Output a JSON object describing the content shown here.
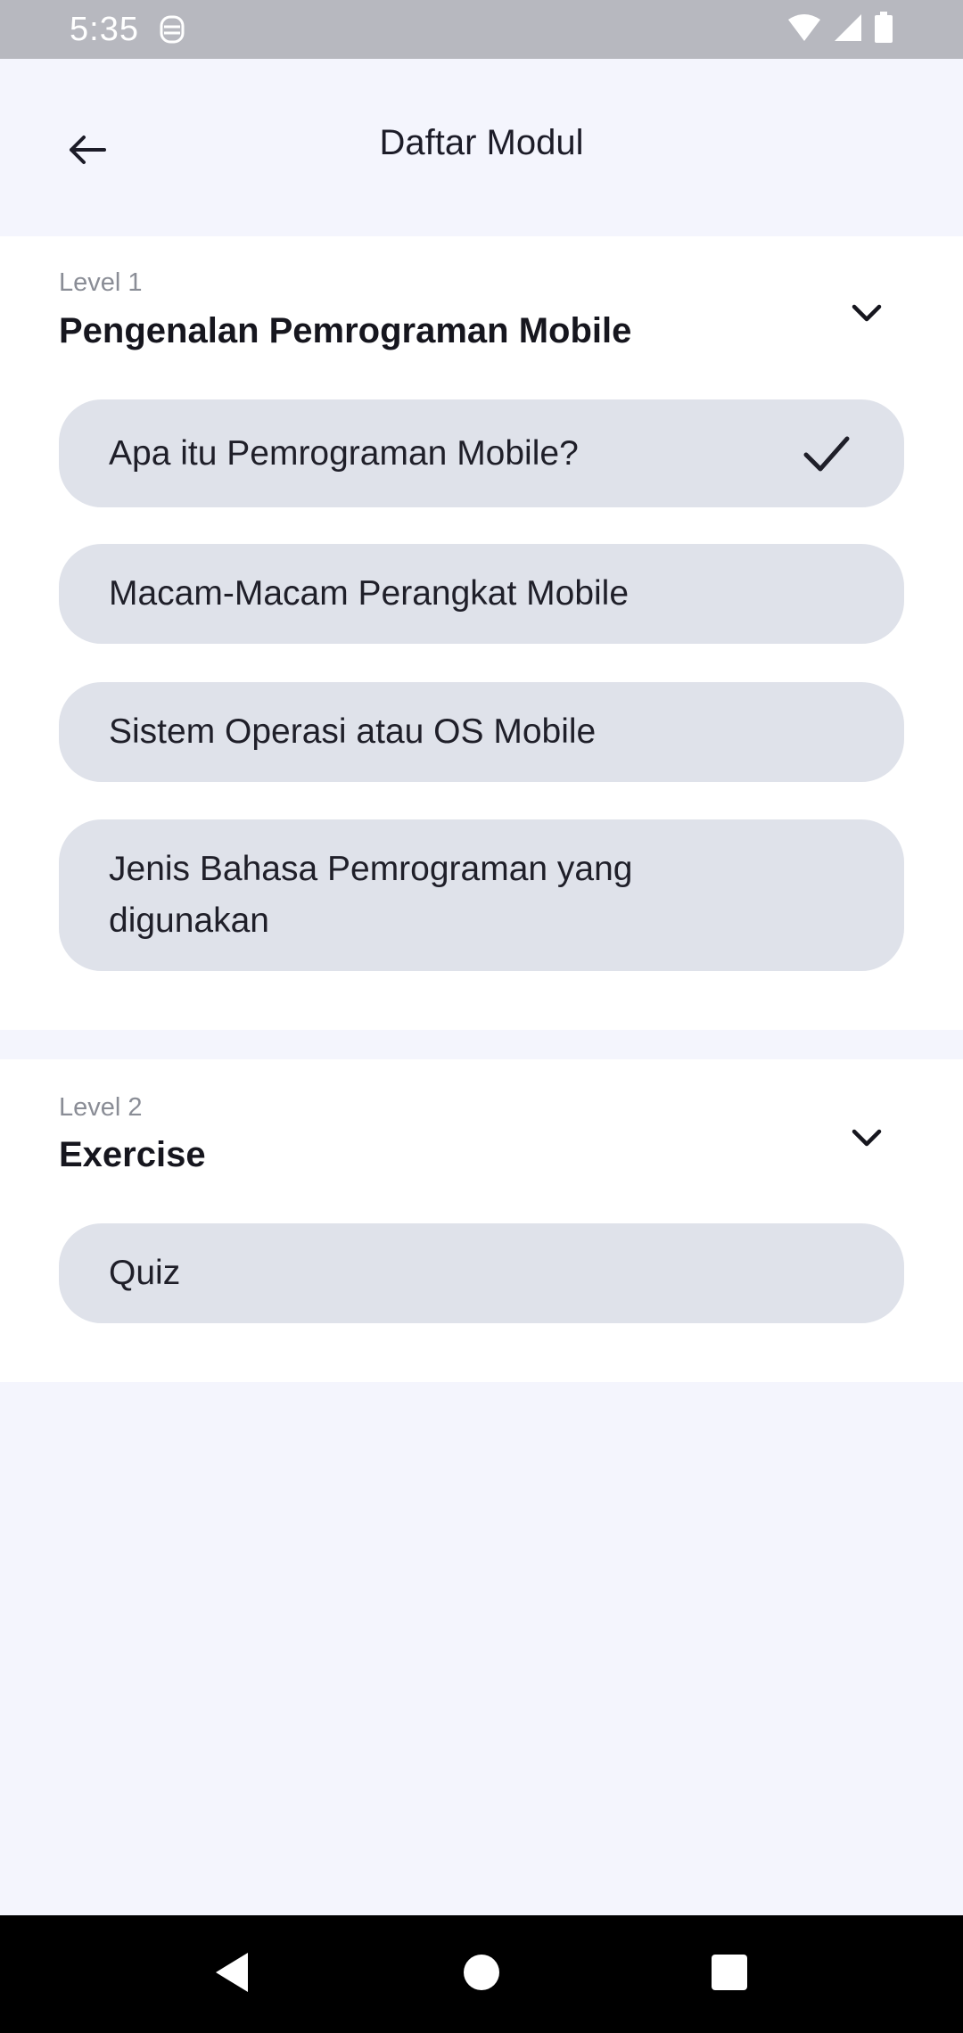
{
  "status_bar": {
    "time": "5:35",
    "icons": [
      "notification-icon",
      "wifi-icon",
      "signal-icon",
      "battery-icon"
    ]
  },
  "app_bar": {
    "title": "Daftar Modul",
    "back_icon": "arrow-left-icon"
  },
  "levels": [
    {
      "label": "Level 1",
      "title": "Pengenalan Pemrograman Mobile",
      "expanded": true,
      "modules": [
        {
          "title": "Apa itu Pemrograman Mobile?",
          "completed": true
        },
        {
          "title": "Macam-Macam Perangkat Mobile",
          "completed": false
        },
        {
          "title": "Sistem Operasi atau OS Mobile",
          "completed": false
        },
        {
          "title": "Jenis Bahasa Pemrograman yang digunakan",
          "completed": false
        }
      ]
    },
    {
      "label": "Level 2",
      "title": "Exercise",
      "expanded": true,
      "modules": [
        {
          "title": "Quiz",
          "completed": false
        }
      ]
    }
  ],
  "nav_bar": {
    "buttons": [
      "back-triangle-icon",
      "home-circle-icon",
      "recents-square-icon"
    ]
  },
  "colors": {
    "background": "#f4f5fd",
    "card": "#ffffff",
    "module_item": "#dfe2ea",
    "status_bar": "#b7b8bf",
    "nav_bar": "#000000"
  }
}
